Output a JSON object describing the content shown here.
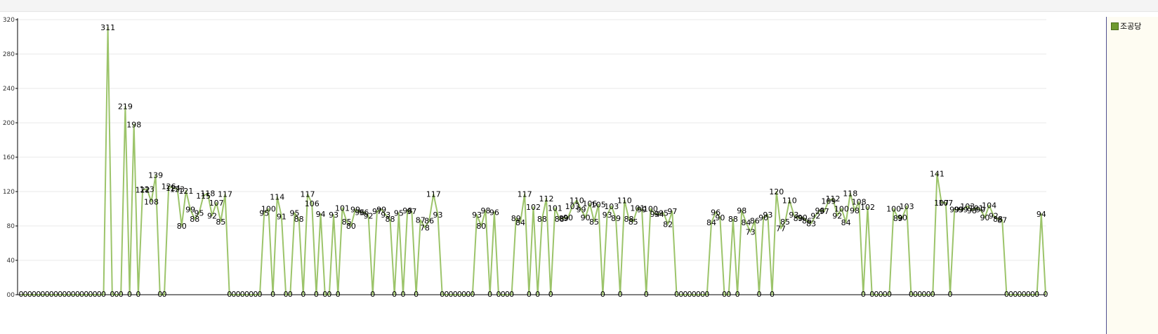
{
  "colors": {
    "line": "#9cc46a",
    "axis": "#000000",
    "grid": "#e8e8e8",
    "swatch": "#6e9a2f"
  },
  "chart_data": {
    "type": "line",
    "ylim": [
      0,
      320
    ],
    "yticks": [
      0,
      40,
      80,
      120,
      160,
      200,
      240,
      280,
      320
    ],
    "ytick_labels": [
      "00",
      "40",
      "80",
      "120",
      "160",
      "200",
      "240",
      "280",
      "320"
    ],
    "grid": true,
    "legend_position": "right",
    "series": [
      {
        "name": "조공당",
        "values": [
          0,
          0,
          0,
          0,
          0,
          0,
          0,
          0,
          0,
          0,
          0,
          0,
          0,
          0,
          0,
          0,
          0,
          0,
          0,
          0,
          311,
          0,
          0,
          0,
          219,
          0,
          198,
          0,
          122,
          123,
          108,
          139,
          0,
          0,
          126,
          124,
          123,
          80,
          121,
          99,
          88,
          95,
          115,
          118,
          92,
          107,
          85,
          117,
          0,
          0,
          0,
          0,
          0,
          0,
          0,
          0,
          95,
          100,
          0,
          114,
          91,
          0,
          0,
          95,
          88,
          0,
          117,
          106,
          0,
          94,
          0,
          0,
          93,
          0,
          101,
          85,
          80,
          99,
          96,
          96,
          92,
          0,
          97,
          99,
          93,
          88,
          0,
          95,
          0,
          98,
          97,
          0,
          87,
          78,
          86,
          117,
          93,
          0,
          0,
          0,
          0,
          0,
          0,
          0,
          0,
          93,
          80,
          98,
          0,
          96,
          0,
          0,
          0,
          0,
          89,
          84,
          117,
          0,
          102,
          0,
          88,
          112,
          0,
          101,
          88,
          89,
          90,
          103,
          110,
          99,
          90,
          106,
          85,
          105,
          0,
          93,
          103,
          89,
          0,
          110,
          88,
          85,
          101,
          99,
          0,
          100,
          94,
          94,
          95,
          82,
          97,
          0,
          0,
          0,
          0,
          0,
          0,
          0,
          0,
          84,
          96,
          90,
          0,
          0,
          88,
          0,
          98,
          84,
          73,
          86,
          0,
          90,
          93,
          0,
          120,
          77,
          85,
          110,
          93,
          89,
          90,
          86,
          83,
          92,
          98,
          97,
          109,
          112,
          92,
          100,
          84,
          118,
          98,
          108,
          0,
          102,
          0,
          0,
          0,
          0,
          0,
          100,
          89,
          90,
          103,
          0,
          0,
          0,
          0,
          0,
          0,
          141,
          107,
          107,
          0,
          99,
          99,
          99,
          103,
          98,
          101,
          99,
          90,
          104,
          92,
          88,
          87,
          0,
          0,
          0,
          0,
          0,
          0,
          0,
          0,
          94,
          0
        ]
      }
    ]
  }
}
